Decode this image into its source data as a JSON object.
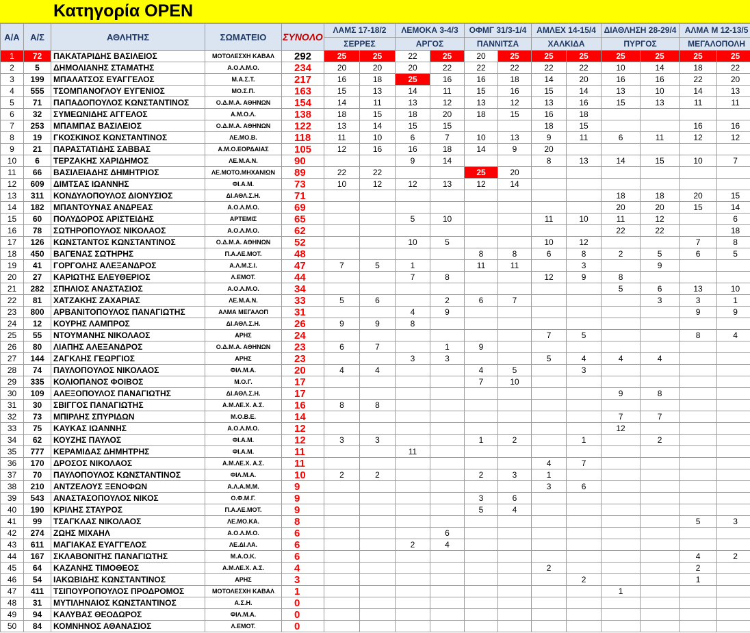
{
  "page_title": "Κατηγορία OPEN",
  "headers": {
    "aa": "Α/Α",
    "as": "Α/Σ",
    "athlete": "ΑΘΛΗΤΗΣ",
    "club": "ΣΩΜΑΤΕΙΟ",
    "total": "ΣΥΝΟΛΟ"
  },
  "events": [
    {
      "name": "ΛΑΜΣ 17-18/2",
      "place": "ΣΕΡΡΕΣ"
    },
    {
      "name": "ΛΕΜΟΚΑ 3-4/3",
      "place": "ΑΡΓΟΣ"
    },
    {
      "name": "ΟΦΜΓ 31/3-1/4",
      "place": "ΠΑΝΝΙΤΣΑ"
    },
    {
      "name": "ΑΜΛΕΧ 14-15/4",
      "place": "ΧΑΛΚΙΔΑ"
    },
    {
      "name": "ΔΙΑΘΛΗΣΗ 28-29/4",
      "place": "ΠΥΡΓΟΣ"
    },
    {
      "name": "ΑΛΜΑ Μ 12-13/5",
      "place": "ΜΕΓΑΛΟΠΟΛΗ"
    }
  ],
  "rows": [
    {
      "aa": "1",
      "as": "72",
      "name": "ΠΑΚΑΤΑΡΙΔΗΣ ΒΑΣΙΛΕΙΟΣ",
      "club": "ΜΟΤΟΛΕΣΧΗ ΚΑΒΑΛ",
      "total": "292",
      "points": [
        "25",
        "25",
        "22",
        "25",
        "20",
        "25",
        "25",
        "25",
        "25",
        "25",
        "25",
        "25"
      ]
    },
    {
      "aa": "2",
      "as": "5",
      "name": "ΔΗΜΟΛΙΑΝΗΣ ΣΤΑΜΑΤΗΣ",
      "club": "Α.Ο.Λ.Μ.Ο.",
      "total": "234",
      "points": [
        "20",
        "20",
        "20",
        "22",
        "22",
        "22",
        "22",
        "22",
        "10",
        "14",
        "18",
        "22"
      ]
    },
    {
      "aa": "3",
      "as": "199",
      "name": "ΜΠΑΛΑΤΣΟΣ ΕΥΑΓΓΕΛΟΣ",
      "club": "Μ.Α.Σ.Τ.",
      "total": "217",
      "points": [
        "16",
        "18",
        "25",
        "16",
        "16",
        "18",
        "14",
        "20",
        "16",
        "16",
        "22",
        "20"
      ]
    },
    {
      "aa": "4",
      "as": "555",
      "name": "ΤΣΟΜΠΑΝΟΓΛΟΥ ΕΥΓΕΝΙΟΣ",
      "club": "ΜΟ.Σ.Π.",
      "total": "163",
      "points": [
        "15",
        "13",
        "14",
        "11",
        "15",
        "16",
        "15",
        "14",
        "13",
        "10",
        "14",
        "13"
      ]
    },
    {
      "aa": "5",
      "as": "71",
      "name": "ΠΑΠΑΔΟΠΟΥΛΟΣ ΚΩΝΣΤΑΝΤΙΝΟΣ",
      "club": "Ο.Δ.Μ.Α. ΑΘΗΝΩΝ",
      "total": "154",
      "points": [
        "14",
        "11",
        "13",
        "12",
        "13",
        "12",
        "13",
        "16",
        "15",
        "13",
        "11",
        "11"
      ]
    },
    {
      "aa": "6",
      "as": "32",
      "name": "ΣΥΜΕΩΝΙΔΗΣ ΑΓΓΕΛΟΣ",
      "club": "Α.Μ.Ο.Λ.",
      "total": "138",
      "points": [
        "18",
        "15",
        "18",
        "20",
        "18",
        "15",
        "16",
        "18",
        "",
        "",
        "",
        ""
      ]
    },
    {
      "aa": "7",
      "as": "253",
      "name": "ΜΠΑΜΠΑΣ ΒΑΣΙΛΕΙΟΣ",
      "club": "Ο.Δ.Μ.Α. ΑΘΗΝΩΝ",
      "total": "122",
      "points": [
        "13",
        "14",
        "15",
        "15",
        "",
        "",
        "18",
        "15",
        "",
        "",
        "16",
        "16"
      ]
    },
    {
      "aa": "8",
      "as": "19",
      "name": "ΓΚΟΣΚΙΝΟΣ ΚΩΝΣΤΑΝΤΙΝΟΣ",
      "club": "ΛΕ.ΜΟ.Β.",
      "total": "118",
      "points": [
        "11",
        "10",
        "6",
        "7",
        "10",
        "13",
        "9",
        "11",
        "6",
        "11",
        "12",
        "12"
      ]
    },
    {
      "aa": "9",
      "as": "21",
      "name": "ΠΑΡΑΣΤΑΤΙΔΗΣ ΣΑΒΒΑΣ",
      "club": "Α.Μ.Ο.ΕΟΡΔΑΙΑΣ",
      "total": "105",
      "points": [
        "12",
        "16",
        "16",
        "18",
        "14",
        "9",
        "20",
        "",
        "",
        "",
        "",
        ""
      ]
    },
    {
      "aa": "10",
      "as": "6",
      "name": "ΤΕΡΖΑΚΗΣ ΧΑΡΙΔΗΜΟΣ",
      "club": "ΛΕ.Μ.Α.Ν.",
      "total": "90",
      "points": [
        "",
        "",
        "9",
        "14",
        "",
        "",
        "8",
        "13",
        "14",
        "15",
        "10",
        "7"
      ]
    },
    {
      "aa": "11",
      "as": "66",
      "name": "ΒΑΣΙΛΕΙΑΔΗΣ ΔΗΜΗΤΡΙΟΣ",
      "club": "ΛΕ.ΜΟΤΟ.ΜΗΧΑΝΙΩΝ",
      "total": "89",
      "points": [
        "22",
        "22",
        "",
        "",
        "25",
        "20",
        "",
        "",
        "",
        "",
        "",
        ""
      ]
    },
    {
      "aa": "12",
      "as": "609",
      "name": "ΔΙΜΤΣΑΣ ΙΩΑΝΝΗΣ",
      "club": "ΦΙ.Α.Μ.",
      "total": "73",
      "points": [
        "10",
        "12",
        "12",
        "13",
        "12",
        "14",
        "",
        "",
        "",
        "",
        "",
        ""
      ]
    },
    {
      "aa": "13",
      "as": "311",
      "name": "ΚΟΝΔΥΛΟΠΟΥΛΟΣ ΔΙΟΝΥΣΙΟΣ",
      "club": "ΔΙ.ΑΘΛ.Σ.Η.",
      "total": "71",
      "points": [
        "",
        "",
        "",
        "",
        "",
        "",
        "",
        "",
        "18",
        "18",
        "20",
        "15"
      ]
    },
    {
      "aa": "14",
      "as": "182",
      "name": "ΜΠΑΝΤΟΥΝΑΣ ΑΝΔΡΕΑΣ",
      "club": "Α.Ο.Λ.Μ.Ο.",
      "total": "69",
      "points": [
        "",
        "",
        "",
        "",
        "",
        "",
        "",
        "",
        "20",
        "20",
        "15",
        "14"
      ]
    },
    {
      "aa": "15",
      "as": "60",
      "name": "ΠΟΛΥΔΟΡΟΣ ΑΡΙΣΤΕΙΔΗΣ",
      "club": "ΑΡΤΕΜΙΣ",
      "total": "65",
      "points": [
        "",
        "",
        "5",
        "10",
        "",
        "",
        "11",
        "10",
        "11",
        "12",
        "",
        "6"
      ]
    },
    {
      "aa": "16",
      "as": "78",
      "name": "ΣΩΤΗΡΟΠΟΥΛΟΣ ΝΙΚΟΛΑΟΣ",
      "club": "Α.Ο.Λ.Μ.Ο.",
      "total": "62",
      "points": [
        "",
        "",
        "",
        "",
        "",
        "",
        "",
        "",
        "22",
        "22",
        "",
        "18"
      ]
    },
    {
      "aa": "17",
      "as": "126",
      "name": "ΚΩΝΣΤΑΝΤΟΣ ΚΩΝΣΤΑΝΤΙΝΟΣ",
      "club": "Ο.Δ.Μ.Α. ΑΘΗΝΩΝ",
      "total": "52",
      "points": [
        "",
        "",
        "10",
        "5",
        "",
        "",
        "10",
        "12",
        "",
        "",
        "7",
        "8"
      ]
    },
    {
      "aa": "18",
      "as": "450",
      "name": "ΒΑΓΕΝΑΣ ΣΩΤΗΡΗΣ",
      "club": "Π.Α.ΛΕ.ΜΟΤ.",
      "total": "48",
      "points": [
        "",
        "",
        "",
        "",
        "8",
        "8",
        "6",
        "8",
        "2",
        "5",
        "6",
        "5"
      ]
    },
    {
      "aa": "19",
      "as": "41",
      "name": "ΓΟΡΓΟΛΗΣ ΑΛΕΞΑΝΔΡΟΣ",
      "club": "Α.Λ.Μ.Σ.Ι.",
      "total": "47",
      "points": [
        "7",
        "5",
        "1",
        "",
        "11",
        "11",
        "",
        "3",
        "",
        "9",
        "",
        ""
      ]
    },
    {
      "aa": "20",
      "as": "27",
      "name": "ΚΑΡΙΩΤΗΣ ΕΛΕΥΘΕΡΙΟΣ",
      "club": "Λ.ΕΜΟΤ.",
      "total": "44",
      "points": [
        "",
        "",
        "7",
        "8",
        "",
        "",
        "12",
        "9",
        "8",
        "",
        "",
        ""
      ]
    },
    {
      "aa": "21",
      "as": "282",
      "name": "ΣΠΗΛΙΟΣ ΑΝΑΣΤΑΣΙΟΣ",
      "club": "Α.Ο.Λ.Μ.Ο.",
      "total": "34",
      "points": [
        "",
        "",
        "",
        "",
        "",
        "",
        "",
        "",
        "5",
        "6",
        "13",
        "10"
      ]
    },
    {
      "aa": "22",
      "as": "81",
      "name": "ΧΑΤΖΑΚΗΣ ΖΑΧΑΡΙΑΣ",
      "club": "ΛΕ.Μ.Α.Ν.",
      "total": "33",
      "points": [
        "5",
        "6",
        "",
        "2",
        "6",
        "7",
        "",
        "",
        "",
        "3",
        "3",
        "1"
      ]
    },
    {
      "aa": "23",
      "as": "800",
      "name": "ΑΡΒΑΝΙΤΟΠΟΥΛΟΣ ΠΑΝΑΓΙΩΤΗΣ",
      "club": "ΑΛΜΑ ΜΕΓΑΛΟΠ",
      "total": "31",
      "points": [
        "",
        "",
        "4",
        "9",
        "",
        "",
        "",
        "",
        "",
        "",
        "9",
        "9"
      ]
    },
    {
      "aa": "24",
      "as": "12",
      "name": "ΚΟΥΡΗΣ ΛΑΜΠΡΟΣ",
      "club": "ΔΙ.ΑΘΛ.Σ.Η.",
      "total": "26",
      "points": [
        "9",
        "9",
        "8",
        "",
        "",
        "",
        "",
        "",
        "",
        "",
        "",
        ""
      ]
    },
    {
      "aa": "25",
      "as": "55",
      "name": "ΝΤΟΥΜΑΝΗΣ ΝΙΚΟΛΑΟΣ",
      "club": "ΑΡΗΣ",
      "total": "24",
      "points": [
        "",
        "",
        "",
        "",
        "",
        "",
        "7",
        "5",
        "",
        "",
        "8",
        "4"
      ]
    },
    {
      "aa": "26",
      "as": "80",
      "name": "ΛΙΑΠΗΣ ΑΛΕΞΑΝΔΡΟΣ",
      "club": "Ο.Δ.Μ.Α. ΑΘΗΝΩΝ",
      "total": "23",
      "points": [
        "6",
        "7",
        "",
        "1",
        "9",
        "",
        "",
        "",
        "",
        "",
        "",
        ""
      ]
    },
    {
      "aa": "27",
      "as": "144",
      "name": "ΖΑΓΚΛΗΣ ΓΕΩΡΓΙΟΣ",
      "club": "ΑΡΗΣ",
      "total": "23",
      "points": [
        "",
        "",
        "3",
        "3",
        "",
        "",
        "5",
        "4",
        "4",
        "4",
        "",
        ""
      ]
    },
    {
      "aa": "28",
      "as": "74",
      "name": "ΠΑΥΛΟΠΟΥΛΟΣ ΝΙΚΟΛΑΟΣ",
      "club": "ΦΙΛ.Μ.Α.",
      "total": "20",
      "points": [
        "4",
        "4",
        "",
        "",
        "4",
        "5",
        "",
        "3",
        "",
        "",
        "",
        ""
      ]
    },
    {
      "aa": "29",
      "as": "335",
      "name": "ΚΟΛΙΟΠΑΝΟΣ ΦΟΙΒΟΣ",
      "club": "Μ.Ο.Γ.",
      "total": "17",
      "points": [
        "",
        "",
        "",
        "",
        "7",
        "10",
        "",
        "",
        "",
        "",
        "",
        ""
      ]
    },
    {
      "aa": "30",
      "as": "109",
      "name": "ΑΛΕΞΟΠΟΥΛΟΣ ΠΑΝΑΓΙΩΤΗΣ",
      "club": "ΔΙ.ΑΘΛ.Σ.Η.",
      "total": "17",
      "points": [
        "",
        "",
        "",
        "",
        "",
        "",
        "",
        "",
        "9",
        "8",
        "",
        ""
      ]
    },
    {
      "aa": "31",
      "as": "30",
      "name": "ΣΒΙΓΓΟΣ ΠΑΝΑΓΙΩΤΗΣ",
      "club": "Α.Μ.ΛΕ.Χ. Α.Σ.",
      "total": "16",
      "points": [
        "8",
        "8",
        "",
        "",
        "",
        "",
        "",
        "",
        "",
        "",
        "",
        ""
      ]
    },
    {
      "aa": "32",
      "as": "73",
      "name": "ΜΠΙΡΛΗΣ ΣΠΥΡΙΔΩΝ",
      "club": "Μ.Ο.Β.Ε.",
      "total": "14",
      "points": [
        "",
        "",
        "",
        "",
        "",
        "",
        "",
        "",
        "7",
        "7",
        "",
        ""
      ]
    },
    {
      "aa": "33",
      "as": "75",
      "name": "ΚΑΥΚΑΣ ΙΩΑΝΝΗΣ",
      "club": "Α.Ο.Λ.Μ.Ο.",
      "total": "12",
      "points": [
        "",
        "",
        "",
        "",
        "",
        "",
        "",
        "",
        "12",
        "",
        "",
        ""
      ]
    },
    {
      "aa": "34",
      "as": "62",
      "name": "ΚΟΥΖΗΣ ΠΑΥΛΟΣ",
      "club": "ΦΙ.Α.Μ.",
      "total": "12",
      "points": [
        "3",
        "3",
        "",
        "",
        "1",
        "2",
        "",
        "1",
        "",
        "2",
        "",
        ""
      ]
    },
    {
      "aa": "35",
      "as": "777",
      "name": "ΚΕΡΑΜΙΔΑΣ ΔΗΜΗΤΡΗΣ",
      "club": "ΦΙ.Α.Μ.",
      "total": "11",
      "points": [
        "",
        "",
        "11",
        "",
        "",
        "",
        "",
        "",
        "",
        "",
        "",
        ""
      ]
    },
    {
      "aa": "36",
      "as": "170",
      "name": "ΔΡΟΣΟΣ ΝΙΚΟΛΑΟΣ",
      "club": "Α.Μ.ΛΕ.Χ. Α.Σ.",
      "total": "11",
      "points": [
        "",
        "",
        "",
        "",
        "",
        "",
        "4",
        "7",
        "",
        "",
        "",
        ""
      ]
    },
    {
      "aa": "37",
      "as": "70",
      "name": "ΠΑΥΛΟΠΟΥΛΟΣ ΚΩΝΣΤΑΝΤΙΝΟΣ",
      "club": "ΦΙΛ.Μ.Α.",
      "total": "10",
      "points": [
        "2",
        "2",
        "",
        "",
        "2",
        "3",
        "1",
        "",
        "",
        "",
        "",
        ""
      ]
    },
    {
      "aa": "38",
      "as": "210",
      "name": "ΑΝΤΖΕΛΟΥΣ ΞΕΝΟΦΩΝ",
      "club": "Α.Λ.Α.Μ.Μ.",
      "total": "9",
      "points": [
        "",
        "",
        "",
        "",
        "",
        "",
        "3",
        "6",
        "",
        "",
        "",
        ""
      ]
    },
    {
      "aa": "39",
      "as": "543",
      "name": "ΑΝΑΣΤΑΣΟΠΟΥΛΟΣ ΝΙΚΟΣ",
      "club": "Ο.Φ.Μ.Γ.",
      "total": "9",
      "points": [
        "",
        "",
        "",
        "",
        "3",
        "6",
        "",
        "",
        "",
        "",
        "",
        ""
      ]
    },
    {
      "aa": "40",
      "as": "190",
      "name": "ΚΡΙΛΗΣ ΣΤΑΥΡΟΣ",
      "club": "Π.Α.ΛΕ.ΜΟΤ.",
      "total": "9",
      "points": [
        "",
        "",
        "",
        "",
        "5",
        "4",
        "",
        "",
        "",
        "",
        "",
        ""
      ]
    },
    {
      "aa": "41",
      "as": "99",
      "name": "ΤΣΑΓΚΛΑΣ ΝΙΚΟΛΑΟΣ",
      "club": "ΛΕ.ΜΟ.ΚΑ.",
      "total": "8",
      "points": [
        "",
        "",
        "",
        "",
        "",
        "",
        "",
        "",
        "",
        "",
        "5",
        "3"
      ]
    },
    {
      "aa": "42",
      "as": "274",
      "name": "ΖΩΗΣ ΜΙΧΑΗΛ",
      "club": "Α.Ο.Λ.Μ.Ο.",
      "total": "6",
      "points": [
        "",
        "",
        "",
        "6",
        "",
        "",
        "",
        "",
        "",
        "",
        "",
        ""
      ]
    },
    {
      "aa": "43",
      "as": "611",
      "name": "ΜΑΓΙΑΚΑΣ ΕΥΑΓΓΕΛΟΣ",
      "club": "ΛΕ.ΔΙ.ΛΑ.",
      "total": "6",
      "points": [
        "",
        "",
        "2",
        "4",
        "",
        "",
        "",
        "",
        "",
        "",
        "",
        ""
      ]
    },
    {
      "aa": "44",
      "as": "167",
      "name": "ΣΚΛΑΒΟΝΙΤΗΣ ΠΑΝΑΓΙΩΤΗΣ",
      "club": "Μ.Α.Ο.Κ.",
      "total": "6",
      "points": [
        "",
        "",
        "",
        "",
        "",
        "",
        "",
        "",
        "",
        "",
        "4",
        "2"
      ]
    },
    {
      "aa": "45",
      "as": "64",
      "name": "ΚΑΖΑΝΗΣ ΤΙΜΟΘΕΟΣ",
      "club": "Α.Μ.ΛΕ.Χ. Α.Σ.",
      "total": "4",
      "points": [
        "",
        "",
        "",
        "",
        "",
        "",
        "2",
        "",
        "",
        "",
        "2",
        ""
      ]
    },
    {
      "aa": "46",
      "as": "54",
      "name": "ΙΑΚΩΒΙΔΗΣ ΚΩΝΣΤΑΝΤΙΝΟΣ",
      "club": "ΑΡΗΣ",
      "total": "3",
      "points": [
        "",
        "",
        "",
        "",
        "",
        "",
        "",
        "2",
        "",
        "",
        "1",
        ""
      ]
    },
    {
      "aa": "47",
      "as": "411",
      "name": "ΤΣΙΠΟΥΡΟΠΟΥΛΟΣ ΠΡΟΔΡΟΜΟΣ",
      "club": "ΜΟΤΟΛΕΣΧΗ ΚΑΒΑΛ",
      "total": "1",
      "points": [
        "",
        "",
        "",
        "",
        "",
        "",
        "",
        "",
        "1",
        "",
        "",
        ""
      ]
    },
    {
      "aa": "48",
      "as": "31",
      "name": "ΜΥΤΙΛΗΝΑΙΟΣ ΚΩΝΣΤΑΝΤΙΝΟΣ",
      "club": "Α.Σ.Η.",
      "total": "0",
      "points": [
        "",
        "",
        "",
        "",
        "",
        "",
        "",
        "",
        "",
        "",
        "",
        ""
      ]
    },
    {
      "aa": "49",
      "as": "94",
      "name": "ΚΑΛΥΒΑΣ ΘΕΟΔΩΡΟΣ",
      "club": "ΦΙΛ.Μ.Α.",
      "total": "0",
      "points": [
        "",
        "",
        "",
        "",
        "",
        "",
        "",
        "",
        "",
        "",
        "",
        ""
      ]
    },
    {
      "aa": "50",
      "as": "84",
      "name": "ΚΟΜΝΗΝΟΣ ΑΘΑΝΑΣΙΟΣ",
      "club": "Λ.ΕΜΟΤ.",
      "total": "0",
      "points": [
        "",
        "",
        "",
        "",
        "",
        "",
        "",
        "",
        "",
        "",
        "",
        ""
      ]
    }
  ],
  "highlights": [
    {
      "row": 0,
      "col": 0
    },
    {
      "row": 0,
      "col": 1
    },
    {
      "row": 0,
      "col": 3
    },
    {
      "row": 0,
      "col": 5
    },
    {
      "row": 0,
      "col": 6
    },
    {
      "row": 0,
      "col": 7
    },
    {
      "row": 0,
      "col": 8
    },
    {
      "row": 0,
      "col": 9
    },
    {
      "row": 0,
      "col": 10
    },
    {
      "row": 0,
      "col": 11
    },
    {
      "row": 2,
      "col": 2
    },
    {
      "row": 10,
      "col": 4
    }
  ],
  "colors": {
    "title_bg": "#ffff00",
    "header_bg": "#dbe5f1",
    "header_text": "#1f3864",
    "total_text": "#ff0000",
    "win_bg": "#ff0000",
    "win_text": "#ffffff"
  }
}
